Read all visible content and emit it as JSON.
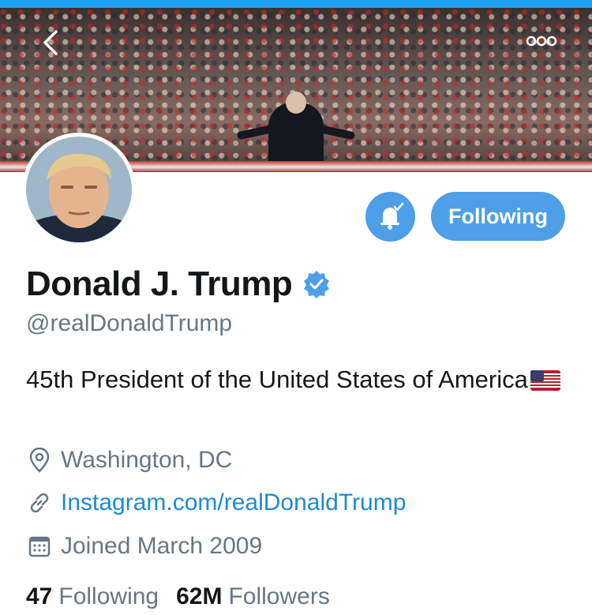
{
  "profile": {
    "display_name": "Donald J. Trump",
    "handle": "@realDonaldTrump",
    "bio": "45th President of the United States of America",
    "location": "Washington, DC",
    "website": "Instagram.com/realDonaldTrump",
    "joined": "Joined March 2009",
    "verified": true
  },
  "actions": {
    "follow_label": "Following"
  },
  "stats": {
    "following_count": "47",
    "following_label": "Following",
    "followers_count": "62M",
    "followers_label": "Followers"
  },
  "icons": {
    "back": "chevron-left-icon",
    "more": "more-options-icon",
    "bell": "notification-bell-icon",
    "verified": "verified-badge-icon",
    "location": "location-pin-icon",
    "link": "link-icon",
    "calendar": "calendar-icon",
    "flag": "us-flag-emoji"
  },
  "colors": {
    "accent": "#4d9fe8",
    "link": "#1d8ad1",
    "secondary_text": "#657786",
    "primary_text": "#14171a"
  }
}
